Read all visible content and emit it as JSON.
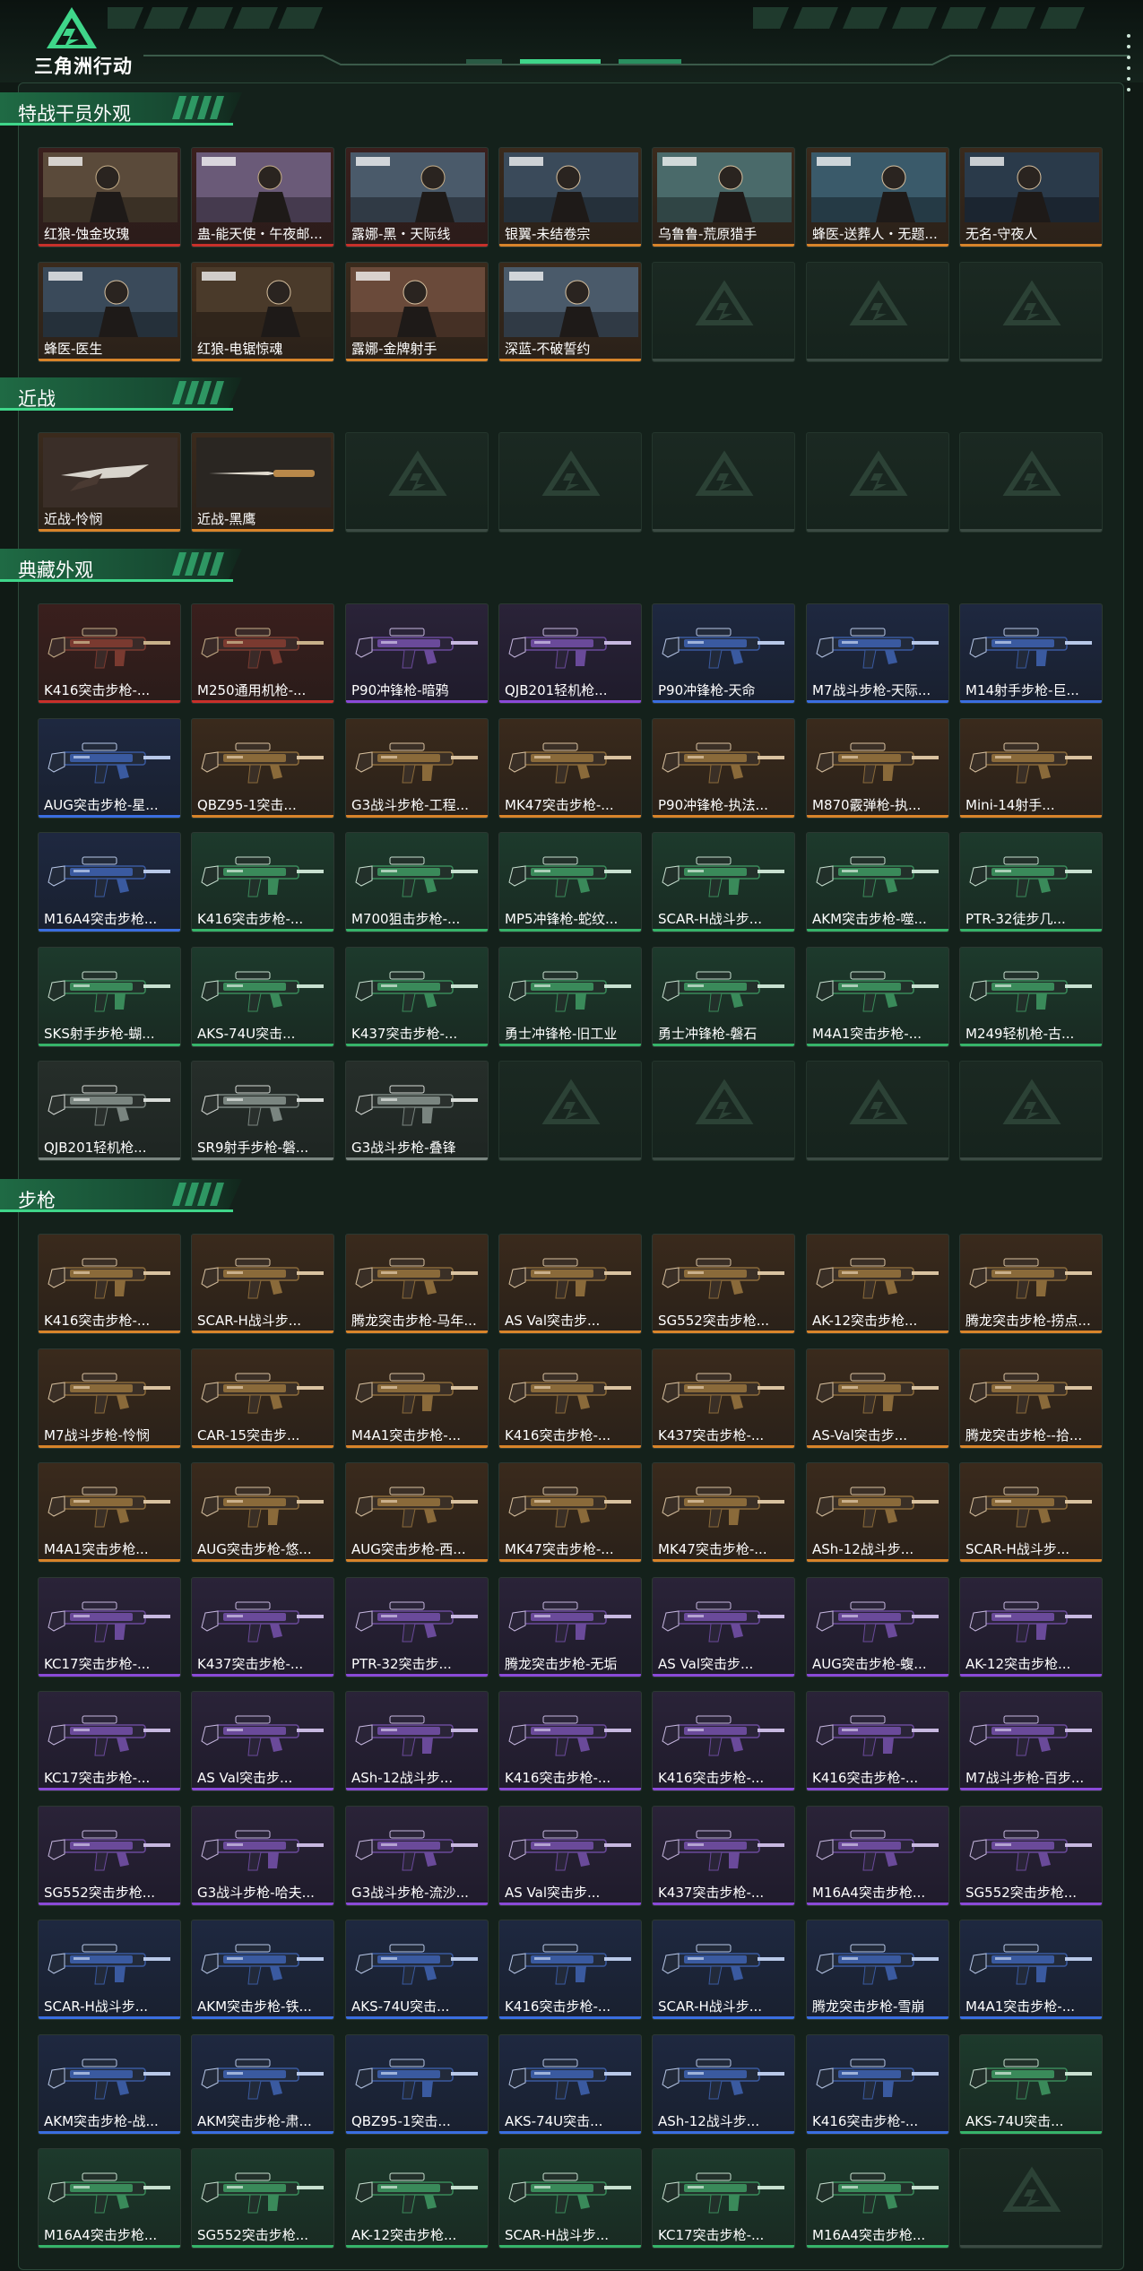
{
  "header": {
    "logo_text": "三角洲行动"
  },
  "sections": [
    {
      "title": "特战干员外观",
      "cards": [
        {
          "label": "红狼-蚀金玫瑰",
          "rarity": "red"
        },
        {
          "label": "蛊-能天使・午夜邮...",
          "rarity": "red"
        },
        {
          "label": "露娜-黑・天际线",
          "rarity": "red"
        },
        {
          "label": "银翼-未结卷宗",
          "rarity": "gold"
        },
        {
          "label": "乌鲁鲁-荒原猎手",
          "rarity": "gold"
        },
        {
          "label": "蜂医-送葬人・无题...",
          "rarity": "gold"
        },
        {
          "label": "无名-守夜人",
          "rarity": "gold"
        },
        {
          "label": "蜂医-医生",
          "rarity": "gold"
        },
        {
          "label": "红狼-电锯惊魂",
          "rarity": "gold"
        },
        {
          "label": "露娜-金牌射手",
          "rarity": "gold"
        },
        {
          "label": "深蓝-不破誓约",
          "rarity": "gold"
        },
        {
          "label": "",
          "rarity": "empty"
        },
        {
          "label": "",
          "rarity": "empty"
        },
        {
          "label": "",
          "rarity": "empty"
        }
      ]
    },
    {
      "title": "近战",
      "cards": [
        {
          "label": "近战-怜悯",
          "rarity": "gold"
        },
        {
          "label": "近战-黑鹰",
          "rarity": "gold"
        },
        {
          "label": "",
          "rarity": "empty"
        },
        {
          "label": "",
          "rarity": "empty"
        },
        {
          "label": "",
          "rarity": "empty"
        },
        {
          "label": "",
          "rarity": "empty"
        },
        {
          "label": "",
          "rarity": "empty"
        }
      ]
    },
    {
      "title": "典藏外观",
      "cards": [
        {
          "label": "K416突击步枪-...",
          "rarity": "red"
        },
        {
          "label": "M250通用机枪-...",
          "rarity": "red"
        },
        {
          "label": "P90冲锋枪-暗鸦",
          "rarity": "purple"
        },
        {
          "label": "QJB201轻机枪...",
          "rarity": "purple"
        },
        {
          "label": "P90冲锋枪-天命",
          "rarity": "blue"
        },
        {
          "label": "M7战斗步枪-天际...",
          "rarity": "blue"
        },
        {
          "label": "M14射手步枪-巨...",
          "rarity": "blue"
        },
        {
          "label": "AUG突击步枪-星...",
          "rarity": "blue"
        },
        {
          "label": "QBZ95-1突击...",
          "rarity": "gold"
        },
        {
          "label": "G3战斗步枪-工程...",
          "rarity": "gold"
        },
        {
          "label": "MK47突击步枪-...",
          "rarity": "gold"
        },
        {
          "label": "P90冲锋枪-执法...",
          "rarity": "gold"
        },
        {
          "label": "M870霰弹枪-执...",
          "rarity": "gold"
        },
        {
          "label": "Mini-14射手...",
          "rarity": "gold"
        },
        {
          "label": "M16A4突击步枪...",
          "rarity": "blue"
        },
        {
          "label": "K416突击步枪-...",
          "rarity": "green"
        },
        {
          "label": "M700狙击步枪-...",
          "rarity": "green"
        },
        {
          "label": "MP5冲锋枪-蛇纹...",
          "rarity": "green"
        },
        {
          "label": "SCAR-H战斗步...",
          "rarity": "green"
        },
        {
          "label": "AKM突击步枪-噬...",
          "rarity": "green"
        },
        {
          "label": "PTR-32徒步几...",
          "rarity": "green"
        },
        {
          "label": "SKS射手步枪-蝴...",
          "rarity": "green"
        },
        {
          "label": "AKS-74U突击...",
          "rarity": "green"
        },
        {
          "label": "K437突击步枪-...",
          "rarity": "green"
        },
        {
          "label": "勇士冲锋枪-旧工业",
          "rarity": "green"
        },
        {
          "label": "勇士冲锋枪-磐石",
          "rarity": "green"
        },
        {
          "label": "M4A1突击步枪-...",
          "rarity": "green"
        },
        {
          "label": "M249轻机枪-古...",
          "rarity": "green"
        },
        {
          "label": "QJB201轻机枪...",
          "rarity": "gray"
        },
        {
          "label": "SR9射手步枪-磐...",
          "rarity": "gray"
        },
        {
          "label": "G3战斗步枪-叠锋",
          "rarity": "gray"
        },
        {
          "label": "",
          "rarity": "empty"
        },
        {
          "label": "",
          "rarity": "empty"
        },
        {
          "label": "",
          "rarity": "empty"
        },
        {
          "label": "",
          "rarity": "empty"
        }
      ]
    },
    {
      "title": "步枪",
      "cards": [
        {
          "label": "K416突击步枪-...",
          "rarity": "gold"
        },
        {
          "label": "SCAR-H战斗步...",
          "rarity": "gold"
        },
        {
          "label": "腾龙突击步枪-马年...",
          "rarity": "gold"
        },
        {
          "label": "AS Val突击步...",
          "rarity": "gold"
        },
        {
          "label": "SG552突击步枪...",
          "rarity": "gold"
        },
        {
          "label": "AK-12突击步枪...",
          "rarity": "gold"
        },
        {
          "label": "腾龙突击步枪-捞点...",
          "rarity": "gold"
        },
        {
          "label": "M7战斗步枪-怜悯",
          "rarity": "gold"
        },
        {
          "label": "CAR-15突击步...",
          "rarity": "gold"
        },
        {
          "label": "M4A1突击步枪-...",
          "rarity": "gold"
        },
        {
          "label": "K416突击步枪-...",
          "rarity": "gold"
        },
        {
          "label": "K437突击步枪-...",
          "rarity": "gold"
        },
        {
          "label": "AS-Val突击步...",
          "rarity": "gold"
        },
        {
          "label": "腾龙突击步枪--拾...",
          "rarity": "gold"
        },
        {
          "label": "M4A1突击步枪...",
          "rarity": "gold"
        },
        {
          "label": "AUG突击步枪-悠...",
          "rarity": "gold"
        },
        {
          "label": "AUG突击步枪-西...",
          "rarity": "gold"
        },
        {
          "label": "MK47突击步枪-...",
          "rarity": "gold"
        },
        {
          "label": "MK47突击步枪-...",
          "rarity": "gold"
        },
        {
          "label": "ASh-12战斗步...",
          "rarity": "gold"
        },
        {
          "label": "SCAR-H战斗步...",
          "rarity": "gold"
        },
        {
          "label": "KC17突击步枪-...",
          "rarity": "purple"
        },
        {
          "label": "K437突击步枪-...",
          "rarity": "purple"
        },
        {
          "label": "PTR-32突击步...",
          "rarity": "purple"
        },
        {
          "label": "腾龙突击步枪-无垢",
          "rarity": "purple"
        },
        {
          "label": "AS Val突击步...",
          "rarity": "purple"
        },
        {
          "label": "AUG突击步枪-蝮...",
          "rarity": "purple"
        },
        {
          "label": "AK-12突击步枪...",
          "rarity": "purple"
        },
        {
          "label": "KC17突击步枪-...",
          "rarity": "purple"
        },
        {
          "label": "AS Val突击步...",
          "rarity": "purple"
        },
        {
          "label": "ASh-12战斗步...",
          "rarity": "purple"
        },
        {
          "label": "K416突击步枪-...",
          "rarity": "purple"
        },
        {
          "label": "K416突击步枪-...",
          "rarity": "purple"
        },
        {
          "label": "K416突击步枪-...",
          "rarity": "purple"
        },
        {
          "label": "M7战斗步枪-百步...",
          "rarity": "purple"
        },
        {
          "label": "SG552突击步枪...",
          "rarity": "purple"
        },
        {
          "label": "G3战斗步枪-哈夫...",
          "rarity": "purple"
        },
        {
          "label": "G3战斗步枪-流沙...",
          "rarity": "purple"
        },
        {
          "label": "AS Val突击步...",
          "rarity": "purple"
        },
        {
          "label": "K437突击步枪-...",
          "rarity": "purple"
        },
        {
          "label": "M16A4突击步枪...",
          "rarity": "purple"
        },
        {
          "label": "SG552突击步枪...",
          "rarity": "purple"
        },
        {
          "label": "SCAR-H战斗步...",
          "rarity": "blue"
        },
        {
          "label": "AKM突击步枪-铁...",
          "rarity": "blue"
        },
        {
          "label": "AKS-74U突击...",
          "rarity": "blue"
        },
        {
          "label": "K416突击步枪-...",
          "rarity": "blue"
        },
        {
          "label": "SCAR-H战斗步...",
          "rarity": "blue"
        },
        {
          "label": "腾龙突击步枪-雪崩",
          "rarity": "blue"
        },
        {
          "label": "M4A1突击步枪-...",
          "rarity": "blue"
        },
        {
          "label": "AKM突击步枪-战...",
          "rarity": "blue"
        },
        {
          "label": "AKM突击步枪-肃...",
          "rarity": "blue"
        },
        {
          "label": "QBZ95-1突击...",
          "rarity": "blue"
        },
        {
          "label": "AKS-74U突击...",
          "rarity": "blue"
        },
        {
          "label": "ASh-12战斗步...",
          "rarity": "blue"
        },
        {
          "label": "K416突击步枪-...",
          "rarity": "blue"
        },
        {
          "label": "AKS-74U突击...",
          "rarity": "green"
        },
        {
          "label": "M16A4突击步枪...",
          "rarity": "green"
        },
        {
          "label": "SG552突击步枪...",
          "rarity": "green"
        },
        {
          "label": "AK-12突击步枪...",
          "rarity": "green"
        },
        {
          "label": "SCAR-H战斗步...",
          "rarity": "green"
        },
        {
          "label": "KC17突击步枪-...",
          "rarity": "green"
        },
        {
          "label": "M16A4突击步枪...",
          "rarity": "green"
        },
        {
          "label": "",
          "rarity": "empty"
        }
      ]
    }
  ]
}
